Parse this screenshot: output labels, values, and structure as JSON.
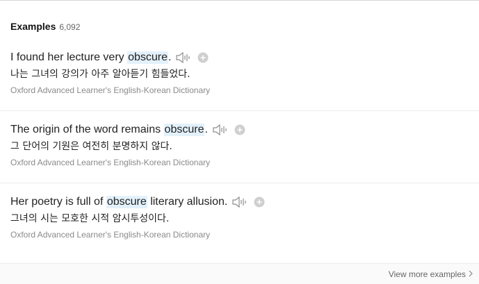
{
  "examples_header": {
    "title": "Examples",
    "count": "6,092"
  },
  "examples": [
    {
      "pre": "I found her lecture very ",
      "highlight": "obscure",
      "post": ".",
      "translation": "나는 그녀의 강의가 아주 알아듣기 힘들었다.",
      "source": "Oxford Advanced Learner's English-Korean Dictionary"
    },
    {
      "pre": "The origin of the word remains ",
      "highlight": "obscure",
      "post": ".",
      "translation": "그 단어의 기원은 여전히 분명하지 않다.",
      "source": "Oxford Advanced Learner's English-Korean Dictionary"
    },
    {
      "pre": "Her poetry is full of ",
      "highlight": "obscure",
      "post": " literary allusion.",
      "translation": "그녀의 시는 모호한 시적 암시투성이다.",
      "source": "Oxford Advanced Learner's English-Korean Dictionary"
    }
  ],
  "footer": {
    "view_more": "View more examples"
  },
  "icons": {
    "speaker": "speaker-icon",
    "add": "plus-circle-icon",
    "chevron": "chevron-right-icon"
  },
  "colors": {
    "highlight_bg": "#e3f1fb",
    "source_text": "#8a8a8a"
  }
}
